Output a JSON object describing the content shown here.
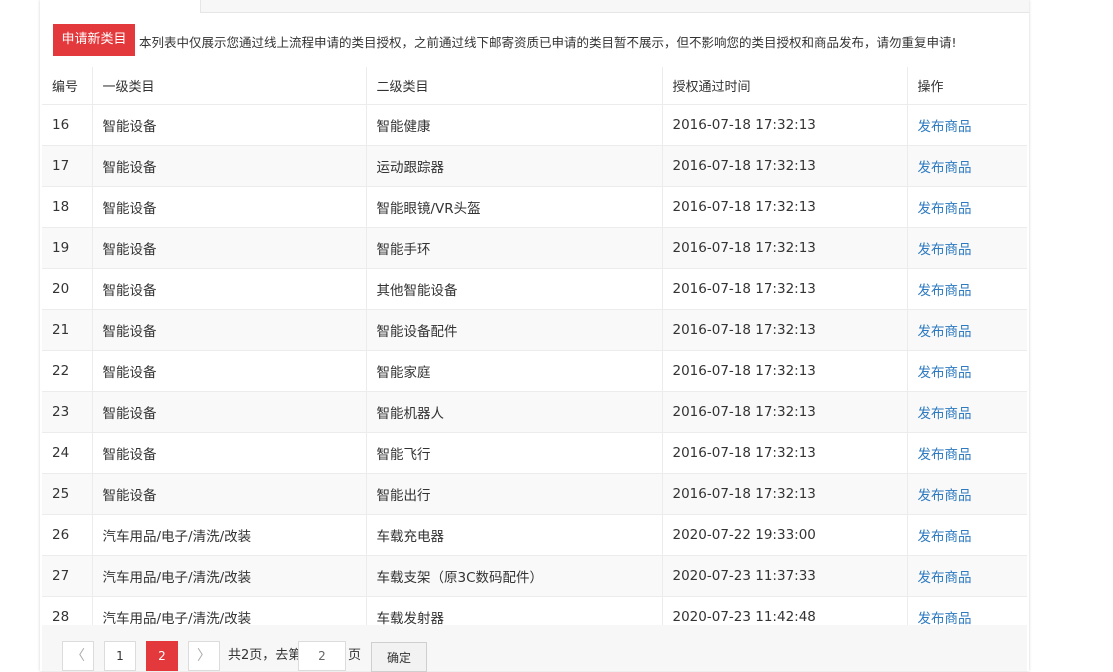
{
  "notice": {
    "apply_button": "申请新类目",
    "text": "本列表中仅展示您通过线上流程申请的类目授权，之前通过线下邮寄资质已申请的类目暂不展示，但不影响您的类目授权和商品发布，请勿重复申请!"
  },
  "table": {
    "headers": [
      "编号",
      "一级类目",
      "二级类目",
      "授权通过时间",
      "操作"
    ],
    "rows": [
      {
        "id": "16",
        "cat1": "智能设备",
        "cat2": "智能健康",
        "time": "2016-07-18 17:32:13",
        "action": "发布商品"
      },
      {
        "id": "17",
        "cat1": "智能设备",
        "cat2": "运动跟踪器",
        "time": "2016-07-18 17:32:13",
        "action": "发布商品"
      },
      {
        "id": "18",
        "cat1": "智能设备",
        "cat2": "智能眼镜/VR头盔",
        "time": "2016-07-18 17:32:13",
        "action": "发布商品"
      },
      {
        "id": "19",
        "cat1": "智能设备",
        "cat2": "智能手环",
        "time": "2016-07-18 17:32:13",
        "action": "发布商品"
      },
      {
        "id": "20",
        "cat1": "智能设备",
        "cat2": "其他智能设备",
        "time": "2016-07-18 17:32:13",
        "action": "发布商品"
      },
      {
        "id": "21",
        "cat1": "智能设备",
        "cat2": "智能设备配件",
        "time": "2016-07-18 17:32:13",
        "action": "发布商品"
      },
      {
        "id": "22",
        "cat1": "智能设备",
        "cat2": "智能家庭",
        "time": "2016-07-18 17:32:13",
        "action": "发布商品"
      },
      {
        "id": "23",
        "cat1": "智能设备",
        "cat2": "智能机器人",
        "time": "2016-07-18 17:32:13",
        "action": "发布商品"
      },
      {
        "id": "24",
        "cat1": "智能设备",
        "cat2": "智能飞行",
        "time": "2016-07-18 17:32:13",
        "action": "发布商品"
      },
      {
        "id": "25",
        "cat1": "智能设备",
        "cat2": "智能出行",
        "time": "2016-07-18 17:32:13",
        "action": "发布商品"
      },
      {
        "id": "26",
        "cat1": "汽车用品/电子/清洗/改装",
        "cat2": "车载充电器",
        "time": "2020-07-22 19:33:00",
        "action": "发布商品"
      },
      {
        "id": "27",
        "cat1": "汽车用品/电子/清洗/改装",
        "cat2": "车载支架（原3C数码配件）",
        "time": "2020-07-23 11:37:33",
        "action": "发布商品"
      },
      {
        "id": "28",
        "cat1": "汽车用品/电子/清洗/改装",
        "cat2": "车载发射器",
        "time": "2020-07-23 11:42:48",
        "action": "发布商品"
      }
    ]
  },
  "pager": {
    "prev_icon": "chevron-left-icon",
    "next_icon": "chevron-right-icon",
    "prev_glyph": "〈",
    "next_glyph": "〉",
    "pages": [
      "1",
      "2"
    ],
    "current_page": "2",
    "total_text": "共2页，去第",
    "page_suffix": "页",
    "goto_value": "2",
    "confirm_label": "确定"
  },
  "colors": {
    "accent": "#e4393c",
    "link": "#2d7ac0"
  }
}
